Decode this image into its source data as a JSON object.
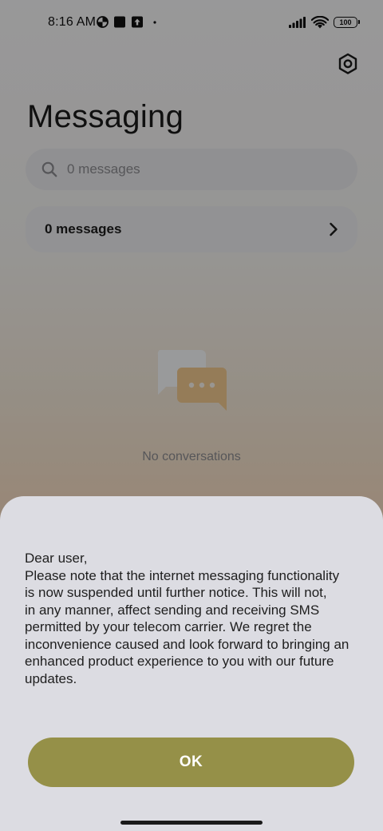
{
  "status_bar": {
    "time": "8:16 AM",
    "battery": "100",
    "icons": [
      "data-saver-icon",
      "square-notification-icon",
      "upload-icon",
      "dot-icon",
      "signal-icon",
      "wifi-icon",
      "battery-icon"
    ]
  },
  "header": {
    "title": "Messaging",
    "settings_icon": "hexagon-settings-icon"
  },
  "search": {
    "placeholder": "0 messages",
    "icon": "search-icon"
  },
  "messages_card": {
    "label": "0 messages",
    "icon": "chevron-right-icon"
  },
  "empty_state": {
    "text": "No conversations",
    "icon": "chat-bubbles-icon"
  },
  "dialog": {
    "message": "Dear user,\nPlease note that the internet messaging functionality\nis now suspended until further notice. This will not,\nin any manner, affect sending and receiving SMS\npermitted by your telecom carrier. We regret the\ninconvenience caused and look forward to bringing an\nenhanced product experience to you with our future\nupdates.",
    "ok_label": "OK"
  },
  "colors": {
    "ok_button": "#959048",
    "sheet_background": "#dcdce2",
    "accent_bubble": "#f0c98e"
  }
}
